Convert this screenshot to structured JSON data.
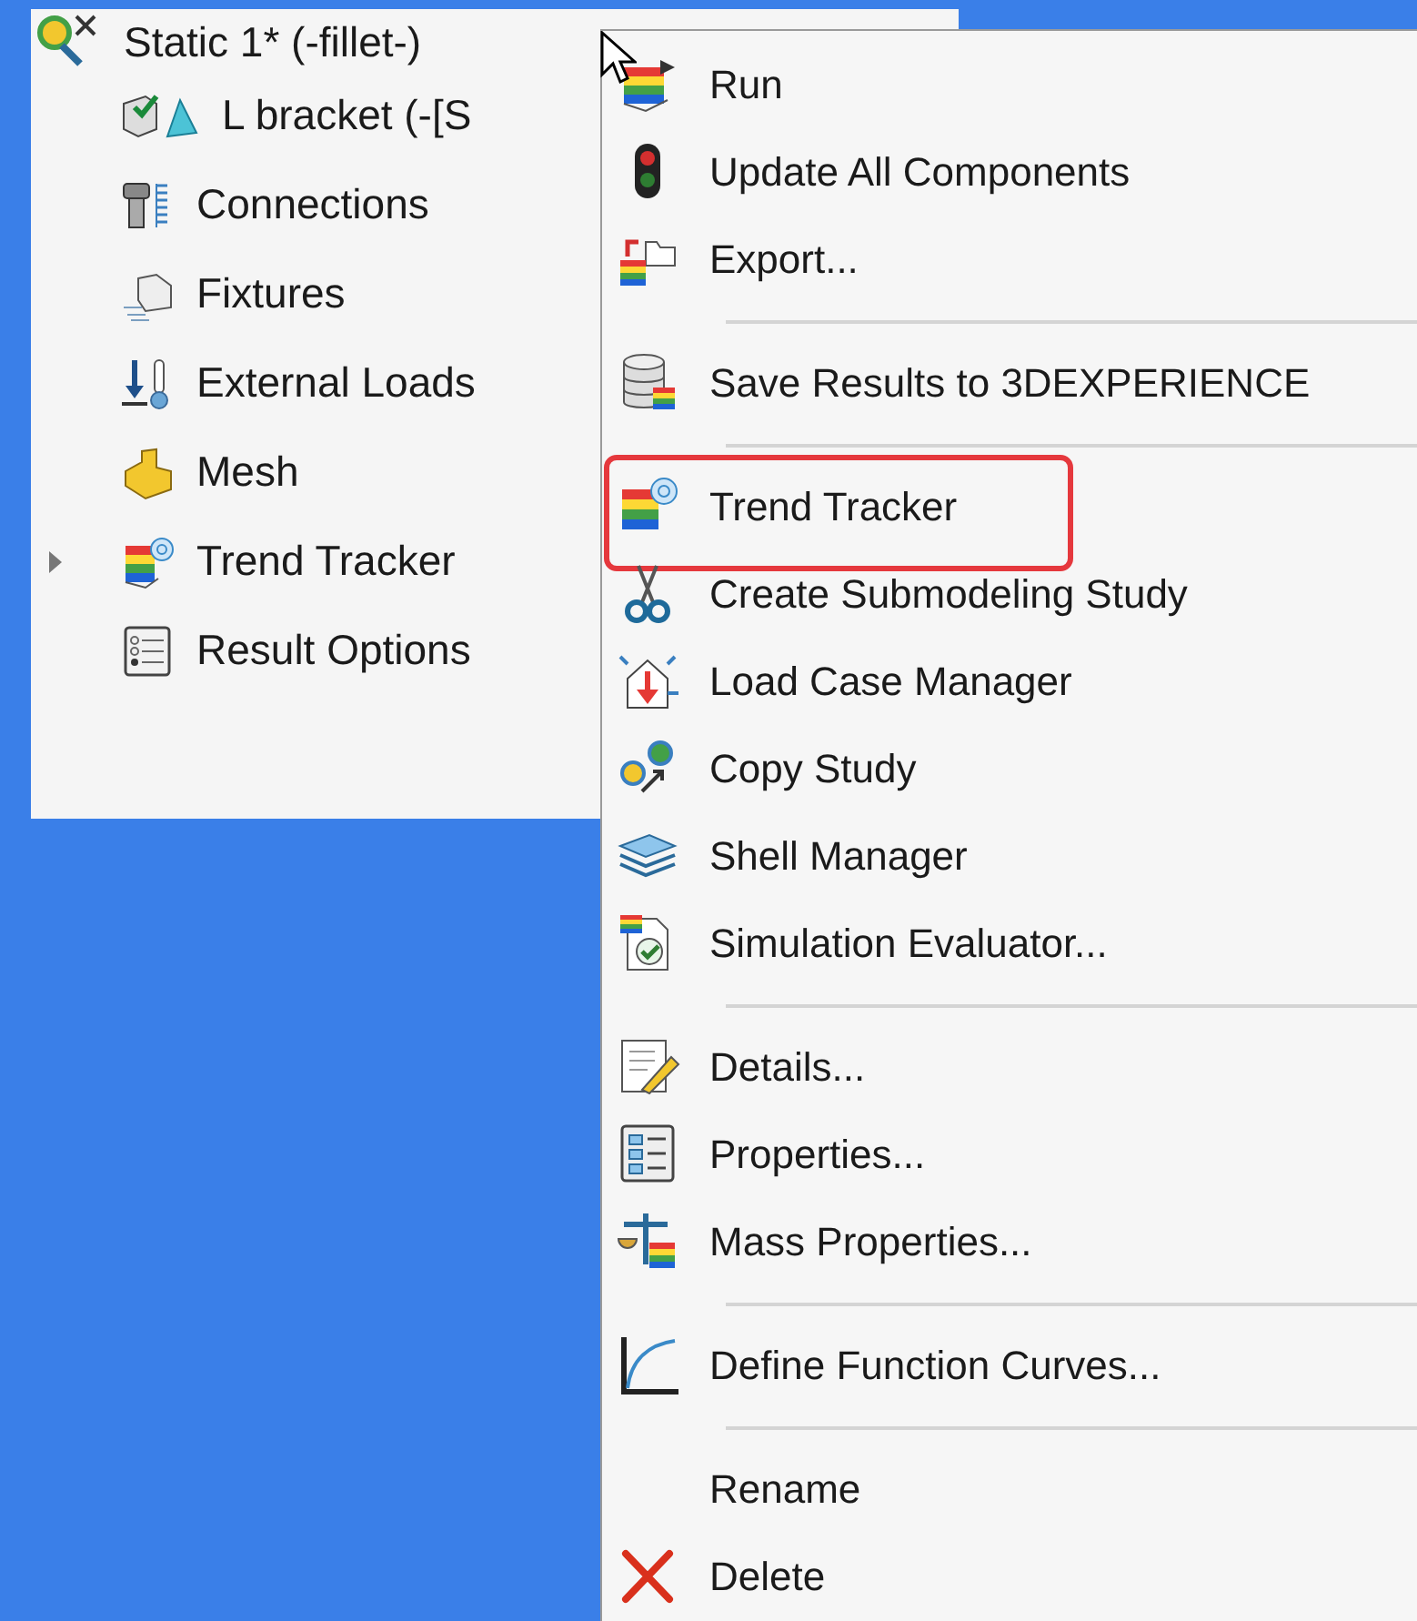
{
  "tree": {
    "root": {
      "label": "Static 1* (-fillet-)"
    },
    "items": [
      {
        "label": "L bracket (-[S",
        "expander": false
      },
      {
        "label": "Connections",
        "expander": false
      },
      {
        "label": "Fixtures",
        "expander": false
      },
      {
        "label": "External Loads",
        "expander": false
      },
      {
        "label": "Mesh",
        "expander": false
      },
      {
        "label": "Trend Tracker",
        "expander": true
      },
      {
        "label": "Result Options",
        "expander": false
      }
    ]
  },
  "menu": {
    "items": [
      {
        "kind": "item",
        "label": "Run",
        "highlighted": false
      },
      {
        "kind": "item",
        "label": "Update All Components",
        "highlighted": false
      },
      {
        "kind": "item",
        "label": "Export...",
        "highlighted": false
      },
      {
        "kind": "separator"
      },
      {
        "kind": "item",
        "label": "Save Results to 3DEXPERIENCE",
        "highlighted": false
      },
      {
        "kind": "separator"
      },
      {
        "kind": "item",
        "label": "Trend Tracker",
        "highlighted": true
      },
      {
        "kind": "item",
        "label": "Create Submodeling Study",
        "highlighted": false
      },
      {
        "kind": "item",
        "label": "Load Case Manager",
        "highlighted": false
      },
      {
        "kind": "item",
        "label": "Copy Study",
        "highlighted": false
      },
      {
        "kind": "item",
        "label": "Shell Manager",
        "highlighted": false
      },
      {
        "kind": "item",
        "label": "Simulation Evaluator...",
        "highlighted": false
      },
      {
        "kind": "separator"
      },
      {
        "kind": "item",
        "label": "Details...",
        "highlighted": false
      },
      {
        "kind": "item",
        "label": "Properties...",
        "highlighted": false
      },
      {
        "kind": "item",
        "label": "Mass Properties...",
        "highlighted": false
      },
      {
        "kind": "separator"
      },
      {
        "kind": "item",
        "label": "Define Function Curves...",
        "highlighted": false
      },
      {
        "kind": "separator"
      },
      {
        "kind": "item",
        "label": "Rename",
        "highlighted": false
      },
      {
        "kind": "item",
        "label": "Delete",
        "highlighted": false
      }
    ]
  }
}
